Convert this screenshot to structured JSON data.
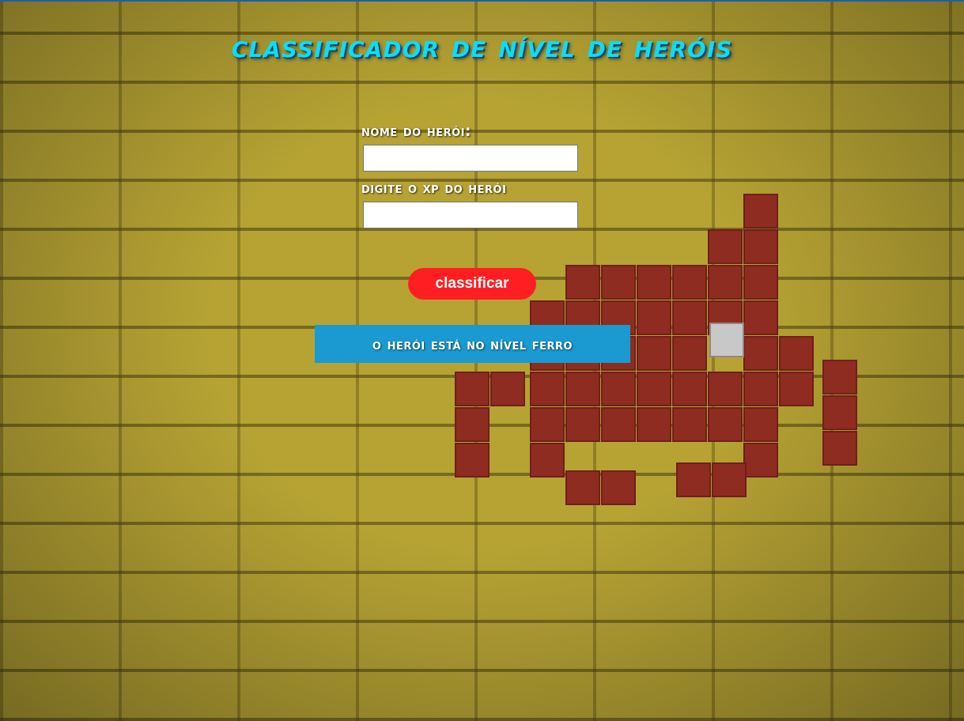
{
  "page": {
    "title": "CLASSIFICADOR DE NÍVEL DE HERÓIS"
  },
  "form": {
    "name_label": "NOME DO HERÓI:",
    "name_value": "",
    "xp_label": "DIGITE O XP DO HERÓI",
    "xp_value": "",
    "submit_label": "classificar"
  },
  "result": {
    "text": "O HERÓI ESTÁ NO NÍVEL FERRO"
  },
  "colors": {
    "title": "#10dcf0",
    "button": "#ff1f22",
    "result_bg": "#1a9ad0",
    "background": "#b9a328",
    "invader": "#8e2c22"
  },
  "background_image": "space-invader-mosaic-on-yellow-brick-wall"
}
